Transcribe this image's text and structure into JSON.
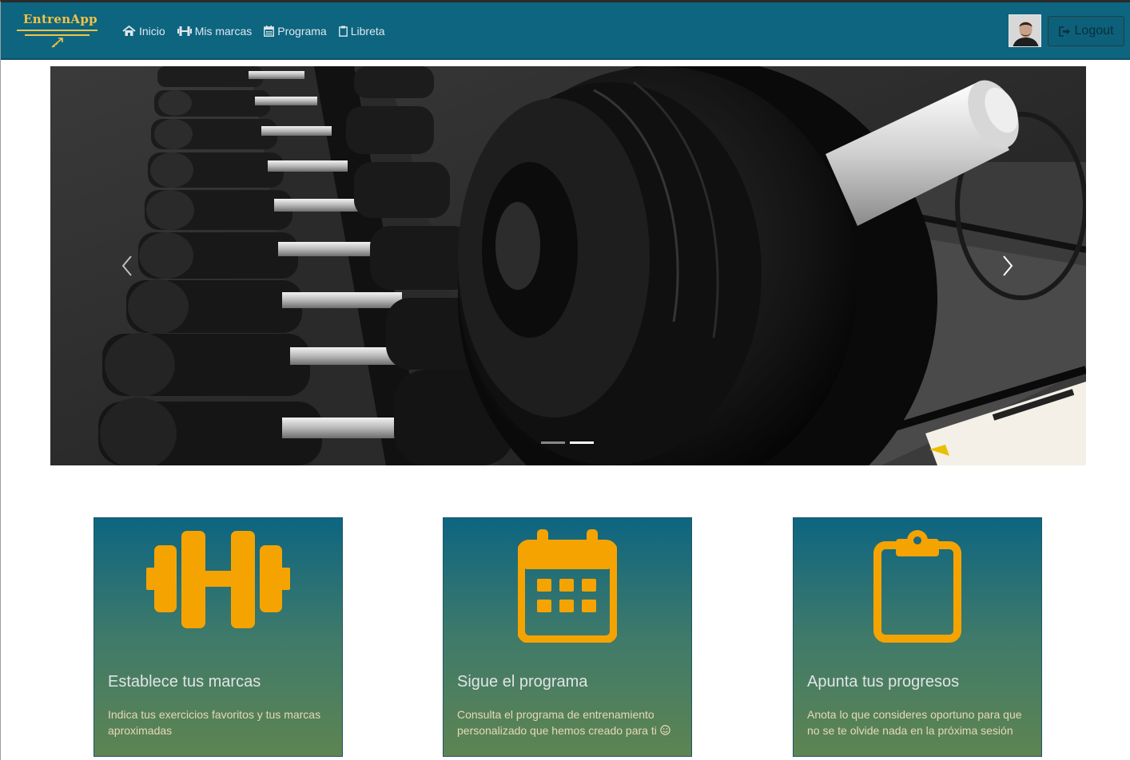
{
  "brand": {
    "name": "EntrenApp"
  },
  "nav": {
    "items": [
      {
        "label": "Inicio",
        "icon": "home-icon"
      },
      {
        "label": "Mis marcas",
        "icon": "dumbbell-icon"
      },
      {
        "label": "Programa",
        "icon": "calendar-icon"
      },
      {
        "label": "Libreta",
        "icon": "clipboard-icon"
      }
    ],
    "logout_label": "Logout"
  },
  "carousel": {
    "slide_count": 2,
    "active_index": 1,
    "image_description": "gym-dumbbell-rack"
  },
  "cards": [
    {
      "icon": "dumbbell-icon",
      "title": "Establece tus marcas",
      "desc": "Indica tus exercicios favoritos y tus marcas aproximadas"
    },
    {
      "icon": "calendar-icon",
      "title": "Sigue el programa",
      "desc": "Consulta el programa de entrenamiento personalizado que hemos creado para ti"
    },
    {
      "icon": "clipboard-icon",
      "title": "Apunta tus progresos",
      "desc": "Anota lo que consideres oportuno para que no se te olvide nada en la próxima sesión"
    }
  ],
  "colors": {
    "navbar": "#0d6580",
    "brand_accent": "#f5c343",
    "card_icon": "#f5a300",
    "card_gradient_top": "#0d6581",
    "card_gradient_bottom": "#5e8452"
  }
}
